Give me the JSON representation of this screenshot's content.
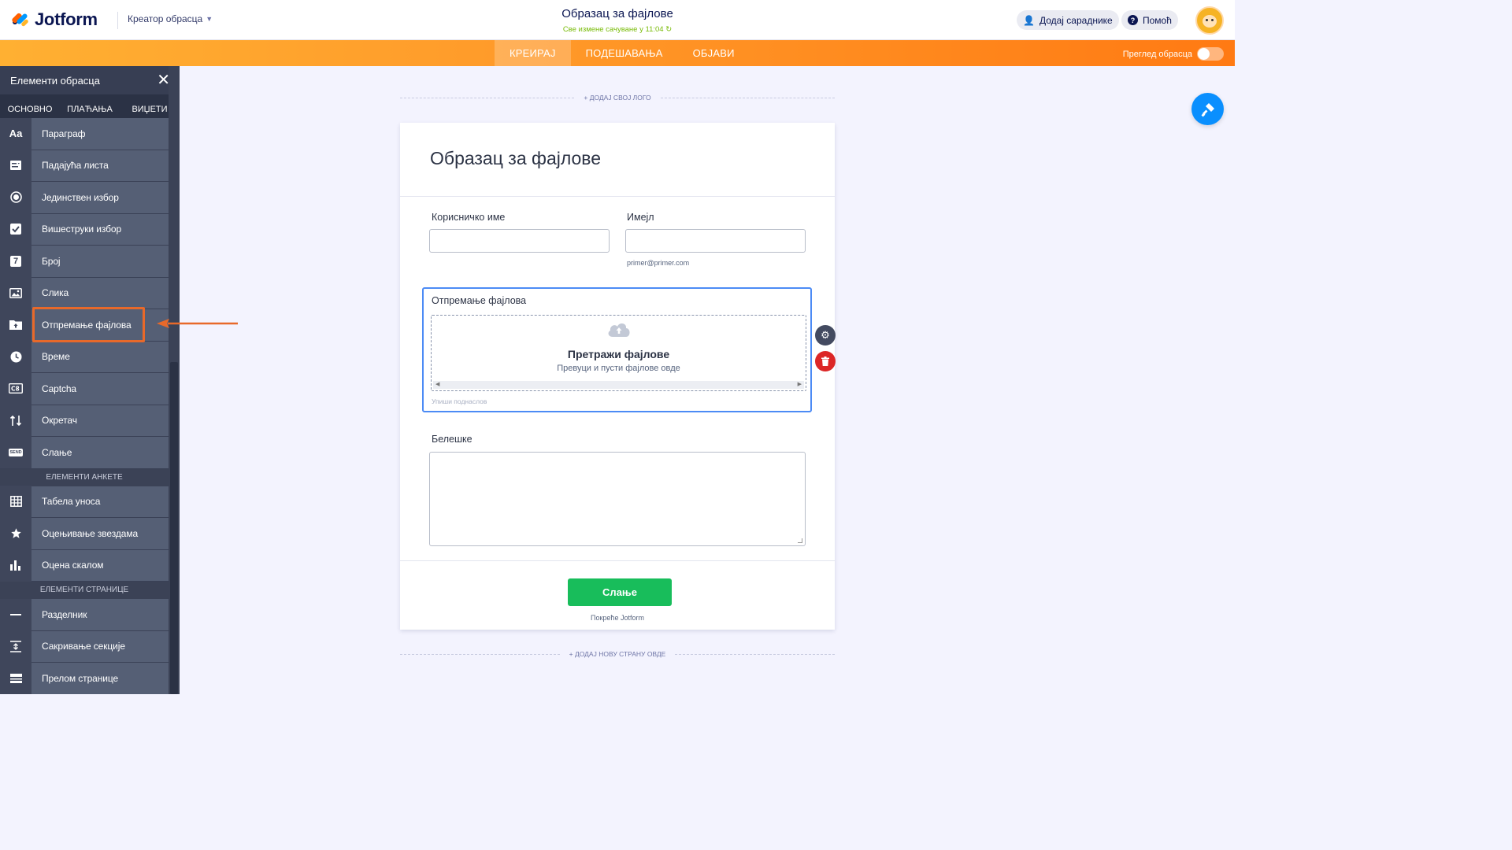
{
  "header": {
    "logo_text": "Jotform",
    "builder_switch": "Креатор обрасца",
    "form_title": "Образац за фајлове",
    "saved_status": "Све измене сачуване у 11:04",
    "add_collaborators": "Додај сараднике",
    "help": "Помоћ"
  },
  "nav": {
    "tabs": [
      "КРЕИРАЈ",
      "ПОДЕШАВАЊА",
      "ОБЈАВИ"
    ],
    "active_tab": "КРЕИРАЈ",
    "preview_label": "Преглед обрасца",
    "preview_on": false
  },
  "sidebar": {
    "title": "Елементи обрасца",
    "tabs": [
      "ОСНОВНО",
      "ПЛАЋАЊА",
      "ВИЏЕТИ"
    ],
    "items": [
      {
        "label": "Параграф",
        "icon": "paragraph-icon"
      },
      {
        "label": "Падајућа листа",
        "icon": "dropdown-icon"
      },
      {
        "label": "Јединствен избор",
        "icon": "radio-icon"
      },
      {
        "label": "Вишеструки избор",
        "icon": "checkbox-icon"
      },
      {
        "label": "Број",
        "icon": "number-icon"
      },
      {
        "label": "Слика",
        "icon": "image-icon"
      },
      {
        "label": "Отпремање фајлова",
        "icon": "file-upload-icon"
      },
      {
        "label": "Време",
        "icon": "clock-icon"
      },
      {
        "label": "Captcha",
        "icon": "captcha-icon"
      },
      {
        "label": "Окретач",
        "icon": "spinner-icon"
      },
      {
        "label": "Слање",
        "icon": "send-icon"
      }
    ],
    "section_survey": "ЕЛЕМЕНТИ АНКЕТЕ",
    "survey_items": [
      {
        "label": "Табела уноса",
        "icon": "table-icon"
      },
      {
        "label": "Оцењивање звездама",
        "icon": "star-icon"
      },
      {
        "label": "Оцена скалом",
        "icon": "bar-chart-icon"
      }
    ],
    "section_page": "ЕЛЕМЕНТИ СТРАНИЦЕ",
    "page_items": [
      {
        "label": "Разделник",
        "icon": "divider-icon"
      },
      {
        "label": "Сакривање секције",
        "icon": "collapse-icon"
      },
      {
        "label": "Прелом странице",
        "icon": "page-break-icon"
      }
    ],
    "item_glyphs": {
      "paragraph": "Aa",
      "number": "7",
      "send": "SEND"
    }
  },
  "canvas": {
    "add_logo": "+ ДОДАЈ СВОЈ ЛОГО",
    "add_page": "+ ДОДАЈ НОВУ СТРАНУ ОВДЕ",
    "form_heading": "Образац за фајлове",
    "username_label": "Корисничко име",
    "email_label": "Имејл",
    "email_sublabel": "primer@primer.com",
    "upload_label": "Отпремање фајлова",
    "upload_browse": "Претражи фајлове",
    "upload_hint": "Превуци и пусти фајлове овде",
    "upload_sublabel_placeholder": "Упиши поднаслов",
    "notes_label": "Белешке",
    "submit_label": "Слање",
    "powered_by": "Покреће Jotform"
  },
  "colors": {
    "accent_orange": "#ff7a13",
    "highlight": "#e8692a",
    "submit_green": "#18bd5b",
    "selected_blue": "#4c8bf5",
    "fab_blue": "#0a8ffe"
  }
}
